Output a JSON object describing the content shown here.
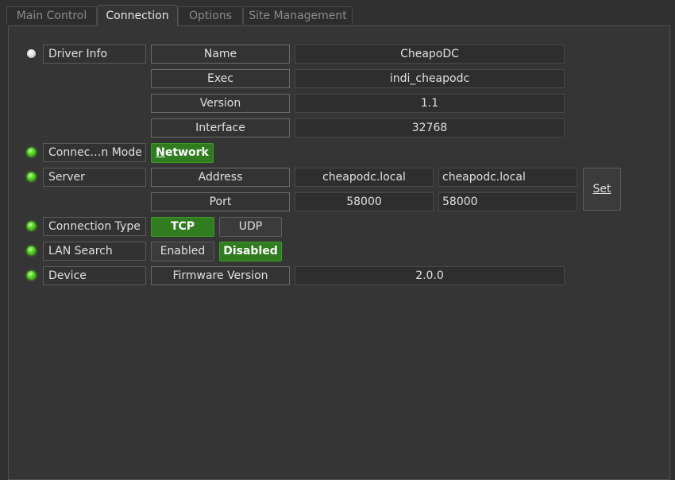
{
  "tabs": [
    {
      "label": "Main Control",
      "active": false
    },
    {
      "label": "Connection",
      "active": true
    },
    {
      "label": "Options",
      "active": false
    },
    {
      "label": "Site Management",
      "active": false
    }
  ],
  "colors": {
    "led_ok": "#4fd11d",
    "led_idle": "#d8d8d8",
    "switch_on": "#2f7d1e"
  },
  "driver_info": {
    "label": "Driver Info",
    "status": "idle",
    "rows": [
      {
        "name": "Name",
        "value": "CheapoDC"
      },
      {
        "name": "Exec",
        "value": "indi_cheapodc"
      },
      {
        "name": "Version",
        "value": "1.1"
      },
      {
        "name": "Interface",
        "value": "32768"
      }
    ]
  },
  "connection_mode": {
    "label": "Connec…n Mode",
    "status": "ok",
    "option": "Network",
    "selected": true
  },
  "server": {
    "label": "Server",
    "status": "ok",
    "address": {
      "name": "Address",
      "current": "cheapodc.local",
      "input": "cheapodc.local"
    },
    "port": {
      "name": "Port",
      "current": "58000",
      "input": "58000"
    },
    "set_label": "Set"
  },
  "connection_type": {
    "label": "Connection Type",
    "status": "ok",
    "tcp": "TCP",
    "udp": "UDP",
    "selected": "TCP"
  },
  "lan_search": {
    "label": "LAN Search",
    "status": "ok",
    "enabled": "Enabled",
    "disabled": "Disabled",
    "selected": "Disabled"
  },
  "device": {
    "label": "Device",
    "status": "ok",
    "firmware_name": "Firmware Version",
    "firmware_value": "2.0.0"
  }
}
